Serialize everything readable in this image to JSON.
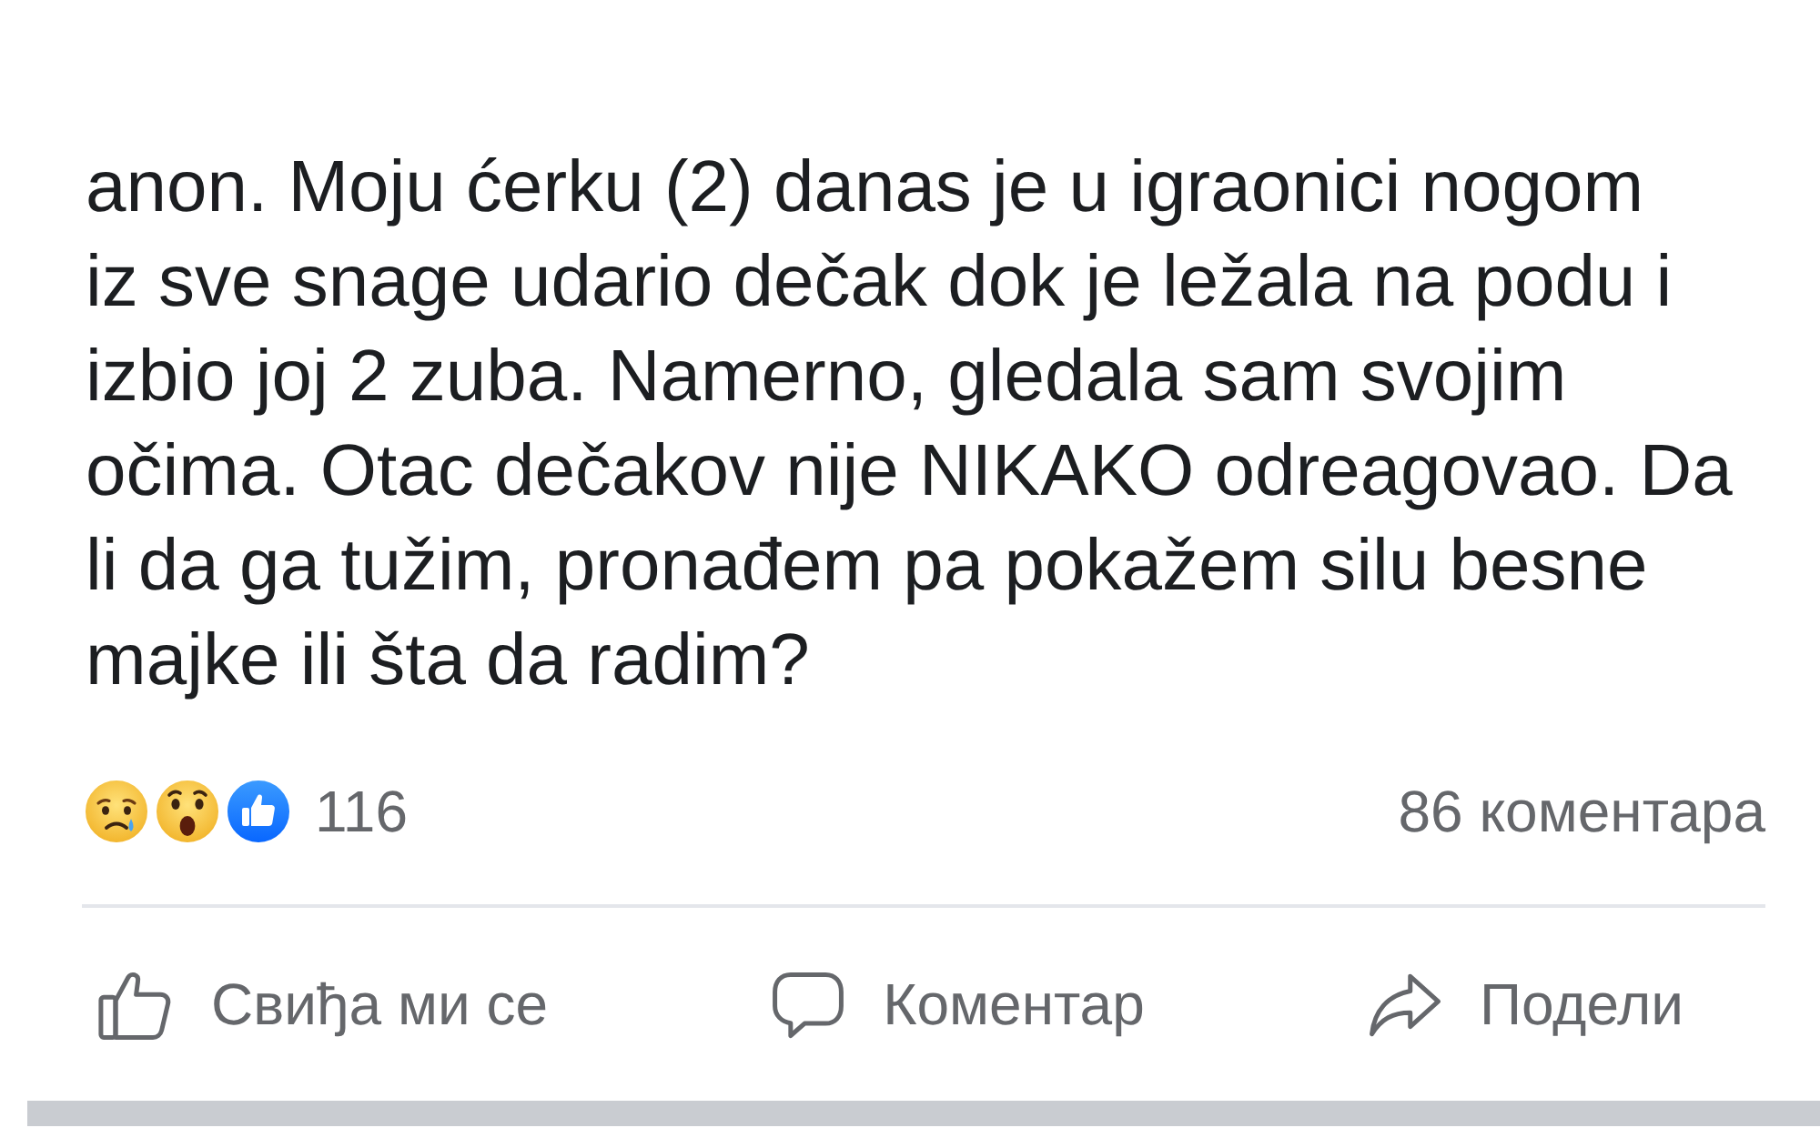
{
  "post": {
    "text": "anon. Moju ćerku (2) danas je u igraonici nogom\niz sve snage udario dečak dok je ležala na podu i\nizbio joj 2 zuba. Namerno, gledala sam svojim\nočima. Otac dečakov nije NIKAKO odreagovao. Da\nli da ga tužim, pronađem pa pokažem silu besne\nmajke ili šta da radim?"
  },
  "reactions": {
    "types": [
      {
        "kind": "sad"
      },
      {
        "kind": "wow"
      },
      {
        "kind": "like"
      }
    ],
    "count": "116",
    "comments": "86 коментара"
  },
  "actions": [
    {
      "kind": "like",
      "label": "Свиђа ми се"
    },
    {
      "kind": "comment",
      "label": "Коментар"
    },
    {
      "kind": "share",
      "label": "Подели"
    }
  ]
}
